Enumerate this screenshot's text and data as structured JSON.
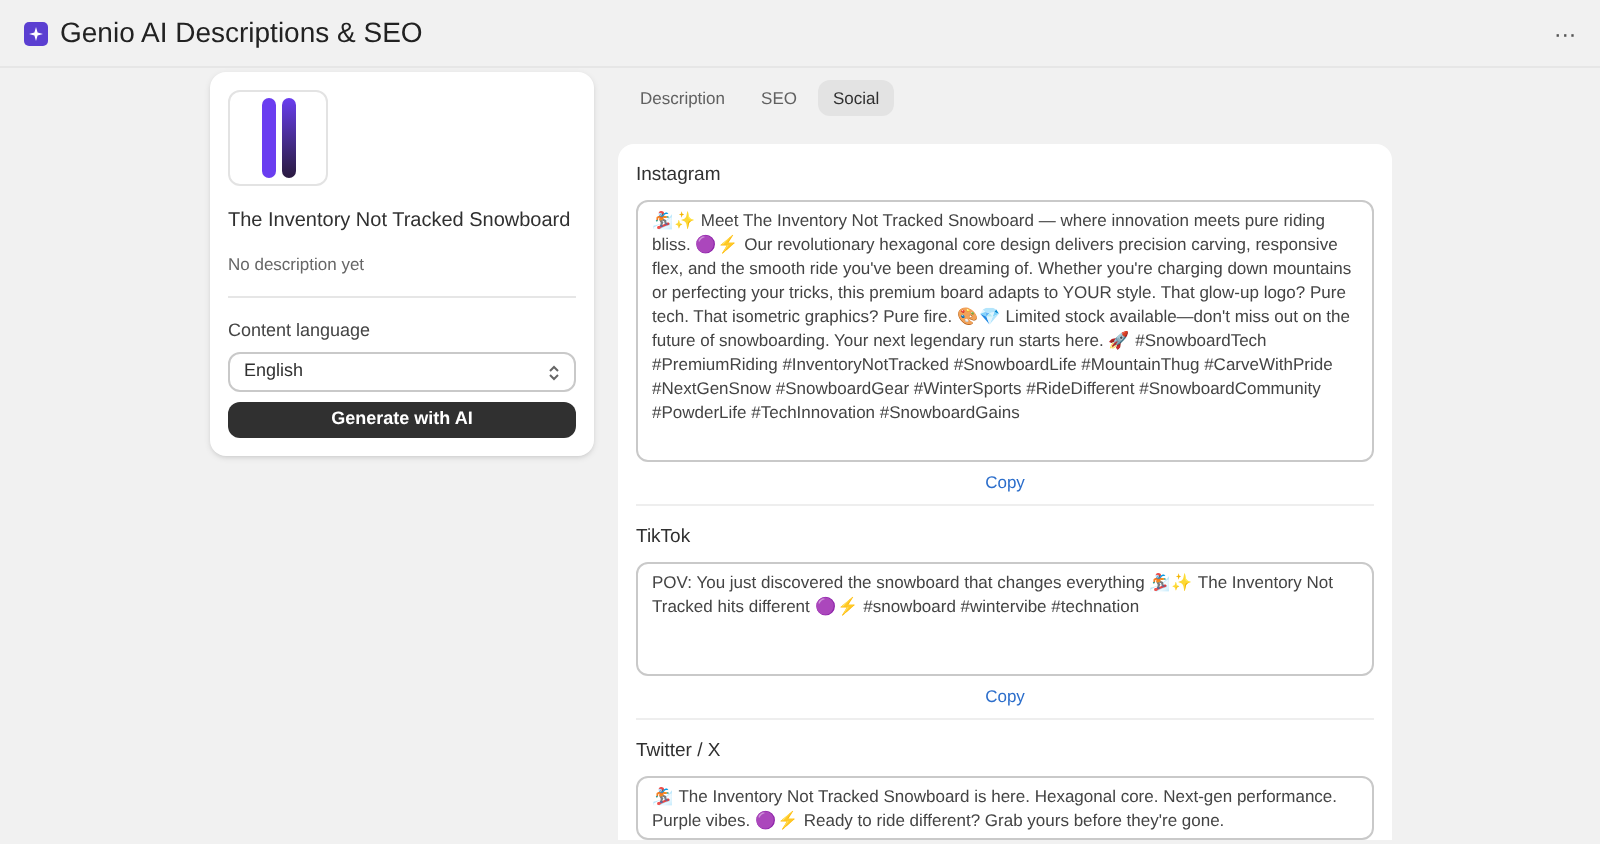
{
  "header": {
    "title": "Genio AI Descriptions & SEO",
    "menu": "···"
  },
  "product": {
    "name": "The Inventory Not Tracked Snowboard",
    "description": "No description yet",
    "language_label": "Content language",
    "language": "English",
    "generate_button": "Generate with AI"
  },
  "tabs": [
    {
      "label": "Description",
      "selected": false
    },
    {
      "label": "SEO",
      "selected": false
    },
    {
      "label": "Social",
      "selected": true
    }
  ],
  "posts": [
    {
      "platform": "Instagram",
      "text": "🏂✨ Meet The Inventory Not Tracked Snowboard — where innovation meets pure riding bliss. 🟣⚡ Our revolutionary hexagonal core design delivers precision carving, responsive flex, and the smooth ride you've been dreaming of. Whether you're charging down mountains or perfecting your tricks, this premium board adapts to YOUR style. That glow-up logo? Pure tech. That isometric graphics? Pure fire. 🎨💎 Limited stock available—don't miss out on the future of snowboarding. Your next legendary run starts here. 🚀 #SnowboardTech #PremiumRiding #InventoryNotTracked #SnowboardLife #MountainThug #CarveWithPride #NextGenSnow #SnowboardGear #WinterSports #RideDifferent #SnowboardCommunity #PowderLife #TechInnovation #SnowboardGains",
      "copy": "Copy"
    },
    {
      "platform": "TikTok",
      "text": "POV: You just discovered the snowboard that changes everything 🏂✨ The Inventory Not Tracked hits different 🟣⚡ #snowboard #wintervibe #technation",
      "copy": "Copy"
    },
    {
      "platform": "Twitter / X",
      "text": "🏂 The Inventory Not Tracked Snowboard is here. Hexagonal core. Next-gen performance. Purple vibes. 🟣⚡ Ready to ride different? Grab yours before they're gone."
    }
  ]
}
